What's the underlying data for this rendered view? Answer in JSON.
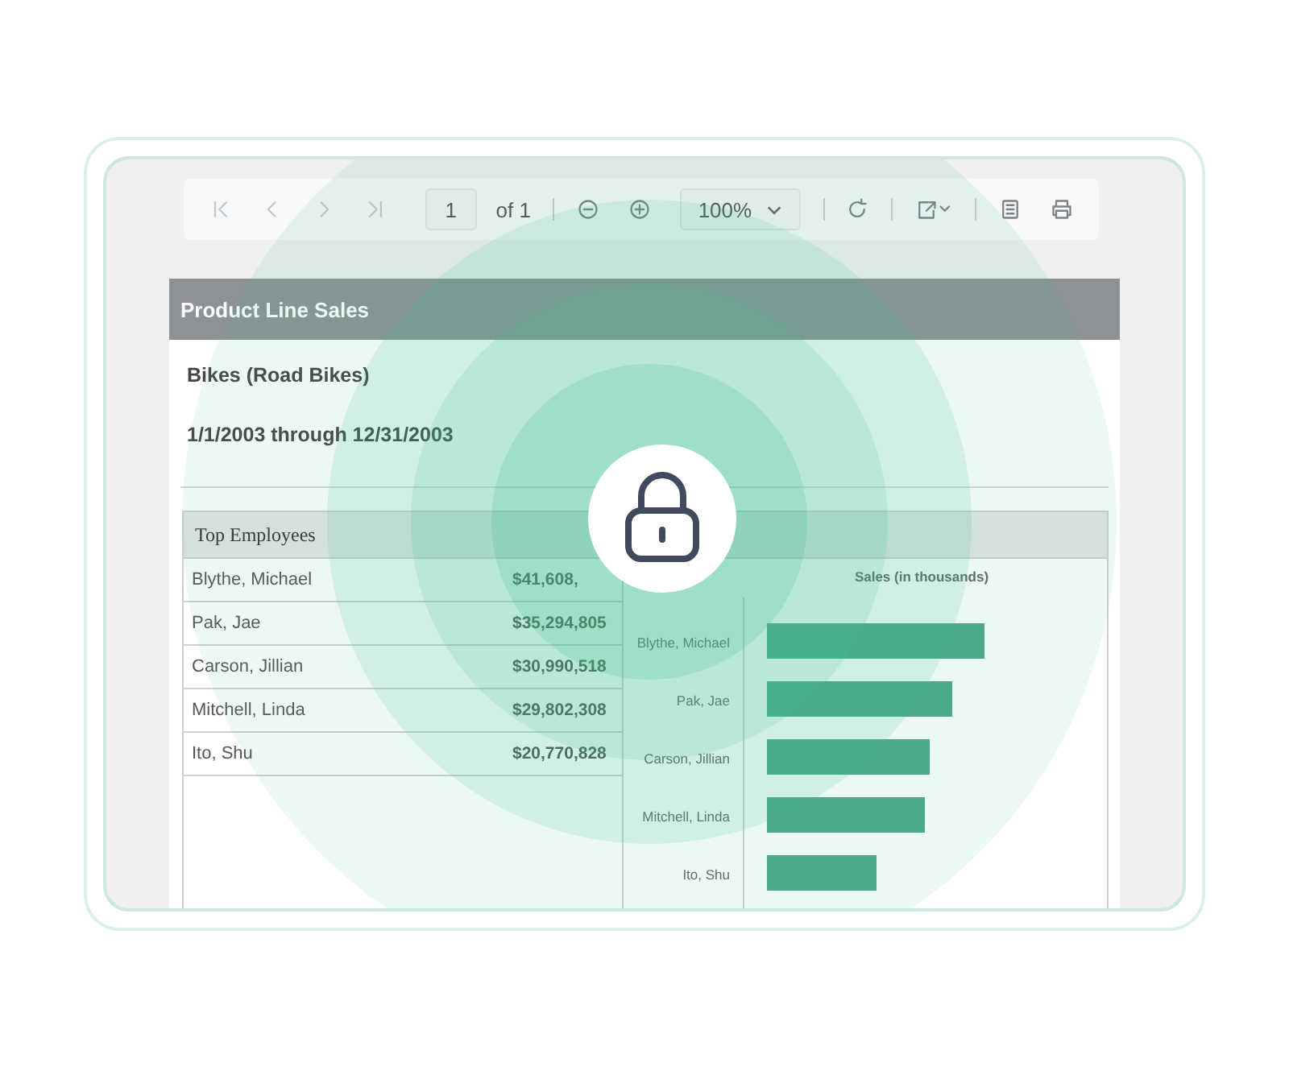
{
  "toolbar": {
    "page_input": "1",
    "page_count": "of 1",
    "zoom": "100%"
  },
  "report": {
    "title": "Product Line Sales",
    "subtitle": "Bikes (Road Bikes)",
    "date_range": "1/1/2003 through 12/31/2003",
    "table": {
      "heading": "Top Employees",
      "rows": [
        {
          "name": "Blythe, Michael",
          "amount": "$41,608,"
        },
        {
          "name": "Pak, Jae",
          "amount": "$35,294,805"
        },
        {
          "name": "Carson, Jillian",
          "amount": "$30,990,518"
        },
        {
          "name": "Mitchell, Linda",
          "amount": "$29,802,308"
        },
        {
          "name": "Ito, Shu",
          "amount": "$20,770,828"
        }
      ]
    },
    "chart": {
      "title": "Sales (in thousands)",
      "labels": [
        "Blythe, Michael",
        "Pak, Jae",
        "Carson, Jillian",
        "Mitchell, Linda",
        "Ito, Shu"
      ]
    }
  }
}
